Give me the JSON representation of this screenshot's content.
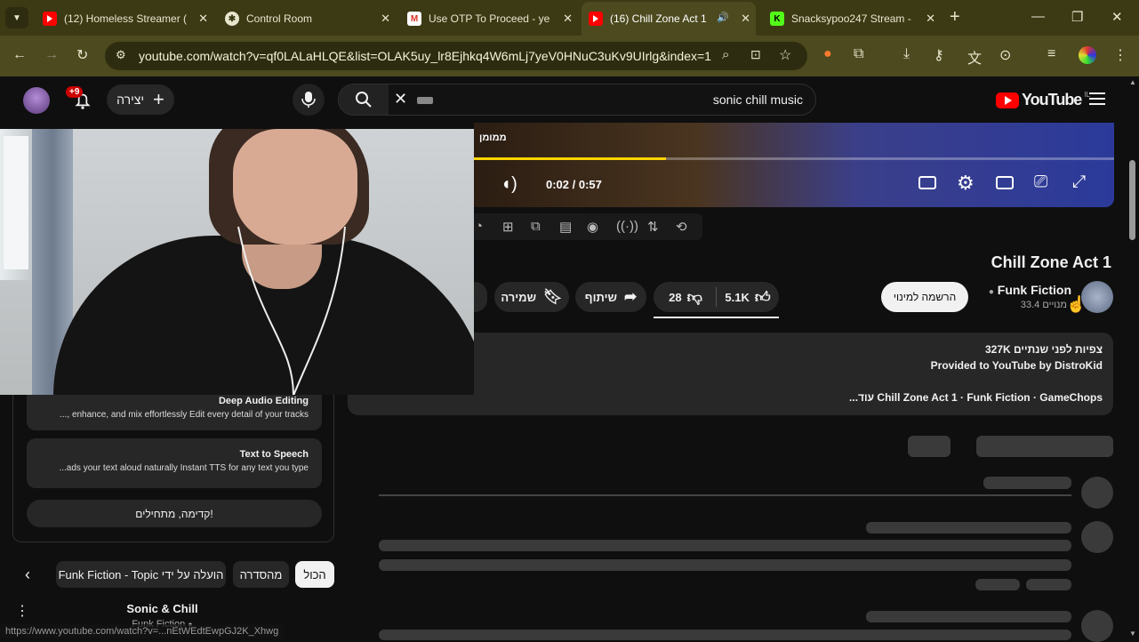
{
  "browser": {
    "tabs": [
      {
        "label": "(12) Homeless Streamer (",
        "icon": "youtube-icon"
      },
      {
        "label": "Control Room",
        "icon": "control-room-icon"
      },
      {
        "label": "Use OTP To Proceed - ye",
        "icon": "gmail-icon"
      },
      {
        "label": "(16) Chill Zone Act 1",
        "icon": "youtube-icon"
      },
      {
        "label": "Snacksypoo247 Stream -",
        "icon": "kick-icon"
      }
    ],
    "url": "youtube.com/watch?v=qf0LALaHLQE&list=OLAK5uy_lr8Ejhkq4W6mLj7yeV0HNuC3uKv9UIrlg&index=1"
  },
  "yt_header": {
    "create_label": "יצירה",
    "notif_badge": "+9",
    "search_query": "sonic chill music",
    "logo_text": "YouTube",
    "logo_country": "IL"
  },
  "player": {
    "overlay_text": "ממומן",
    "time": "0:02 / 0:57",
    "progress": 0.3
  },
  "video": {
    "title": "Chill Zone Act 1",
    "channel": "Funk Fiction",
    "subscribers": "33.4 מנויים",
    "subscribe_label": "הרשמה למינוי",
    "likes": "5.1K",
    "dislikes": "28",
    "share_label": "שיתוף",
    "save_label": "שמירה"
  },
  "description": {
    "meta": "327K צפיות  לפני שנתיים",
    "line1": "Provided to YouTube by DistroKid",
    "line2": "Chill Zone Act 1 · Funk Fiction · GameChops",
    "more": "...עוד"
  },
  "left_panel": {
    "cards": [
      {
        "title": "Deep Audio Editing",
        "text": "..., enhance, and mix effortlessly Edit every detail of your tracks"
      },
      {
        "title": "Text to Speech",
        "text": "...ads your text aloud naturally Instant TTS for any text you type"
      }
    ],
    "cta": "קדימה, מתחילים!"
  },
  "chips": [
    "הכול",
    "מהסדרה",
    "Funk Fiction - Topic הועלה על ידי"
  ],
  "playlist_item": {
    "title": "Sonic & Chill",
    "channel": "Funk Fiction"
  },
  "status_url": "https://www.youtube.com/watch?v=...nEtWEdtEwpGJ2K_Xhwg"
}
